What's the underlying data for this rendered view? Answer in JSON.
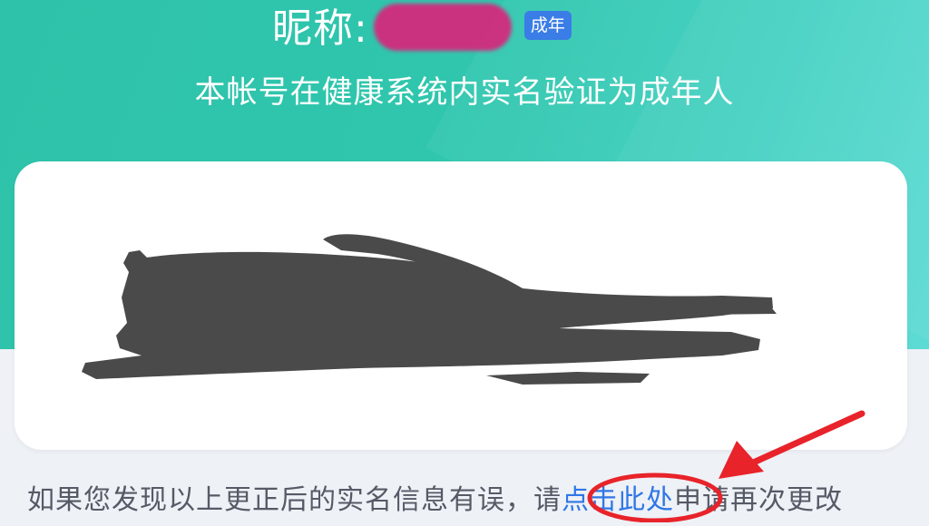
{
  "header": {
    "nickname_label": "昵称:",
    "badge_label": "成年",
    "verify_text": "本帐号在健康系统内实名验证为成年人"
  },
  "notice": {
    "prefix": "如果您发现以上更正后的实名信息有误，请",
    "link_label": "点击此处",
    "suffix": "申请再次更改"
  },
  "colors": {
    "hero_bg": "#2fc6ad",
    "badge_bg": "#3a7de6",
    "link": "#2f77e6",
    "annotation": "#e8232a",
    "redaction": "#4a4a4a"
  }
}
